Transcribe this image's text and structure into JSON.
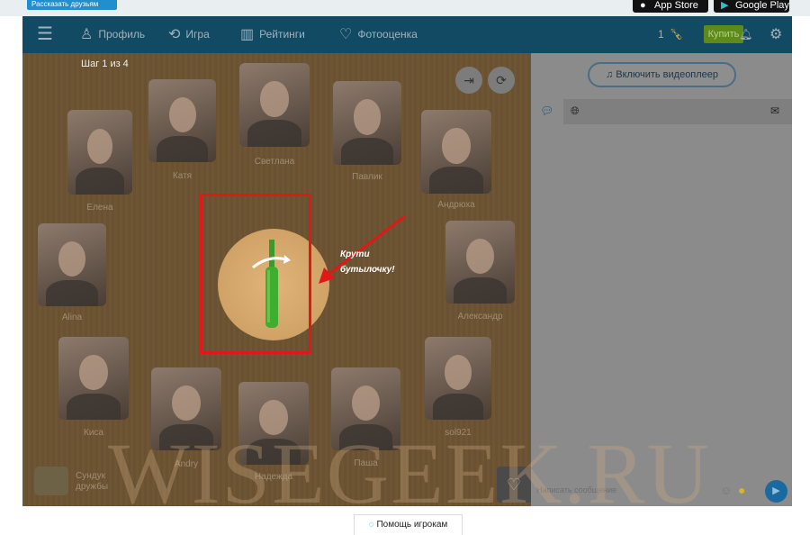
{
  "top": {
    "share_label": "Рассказать друзьям",
    "app_store": "App Store",
    "google_play": "Google Play"
  },
  "nav": {
    "items": [
      {
        "label": "Профиль",
        "icon": "profile-icon"
      },
      {
        "label": "Игра",
        "icon": "game-icon"
      },
      {
        "label": "Рейтинги",
        "icon": "ratings-icon"
      },
      {
        "label": "Фотооценка",
        "icon": "photo-rating-icon"
      }
    ],
    "bottles_count": "1",
    "buy_label": "Купить"
  },
  "game": {
    "step": "Шаг 1 из 4",
    "hint_line1": "Крути",
    "hint_line2": "бутылочку!",
    "players": [
      "Елена",
      "Катя",
      "Светлана",
      "Павлик",
      "Андрюха",
      "Alina",
      "Александр",
      "Киса",
      "Andry",
      "Надежда",
      "Паша",
      "sol921"
    ],
    "chest_label_1": "Сундук",
    "chest_label_2": "дружбы"
  },
  "chat": {
    "video_label": "Включить видеоплеер",
    "input_placeholder": "Написать сообщение"
  },
  "footer": {
    "help_label": "Помощь игрокам"
  },
  "watermark": "WISEGEEK.RU",
  "colors": {
    "nav": "#134a63",
    "buy": "#5d8a1a",
    "highlight": "#e01818"
  }
}
